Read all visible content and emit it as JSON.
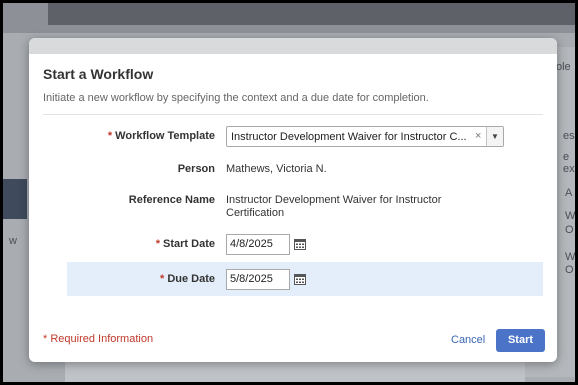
{
  "background": {
    "fragments": [
      "ole",
      "essi",
      "e ex",
      "A",
      "W",
      "O",
      "W",
      "O",
      "w"
    ]
  },
  "modal": {
    "title": "Start a Workflow",
    "description": "Initiate a new workflow by specifying the context and a due date for completion.",
    "fields": {
      "workflow_template": {
        "label": "Workflow Template",
        "required_marker": "*",
        "value": "Instructor Development Waiver for Instructor C...",
        "clear_glyph": "×",
        "arrow_glyph": "▼"
      },
      "person": {
        "label": "Person",
        "value": "Mathews, Victoria N."
      },
      "reference_name": {
        "label": "Reference Name",
        "value_line1": "Instructor Development Waiver for Instructor",
        "value_line2": "Certification"
      },
      "start_date": {
        "label": "Start Date",
        "required_marker": "*",
        "value": "4/8/2025"
      },
      "due_date": {
        "label": "Due Date",
        "required_marker": "*",
        "value": "5/8/2025"
      }
    },
    "required_note": "* Required Information",
    "cancel_label": "Cancel",
    "start_label": "Start"
  },
  "colors": {
    "accent": "#4b74c8",
    "required": "#c0392b",
    "highlight_row": "#e3eefa"
  }
}
